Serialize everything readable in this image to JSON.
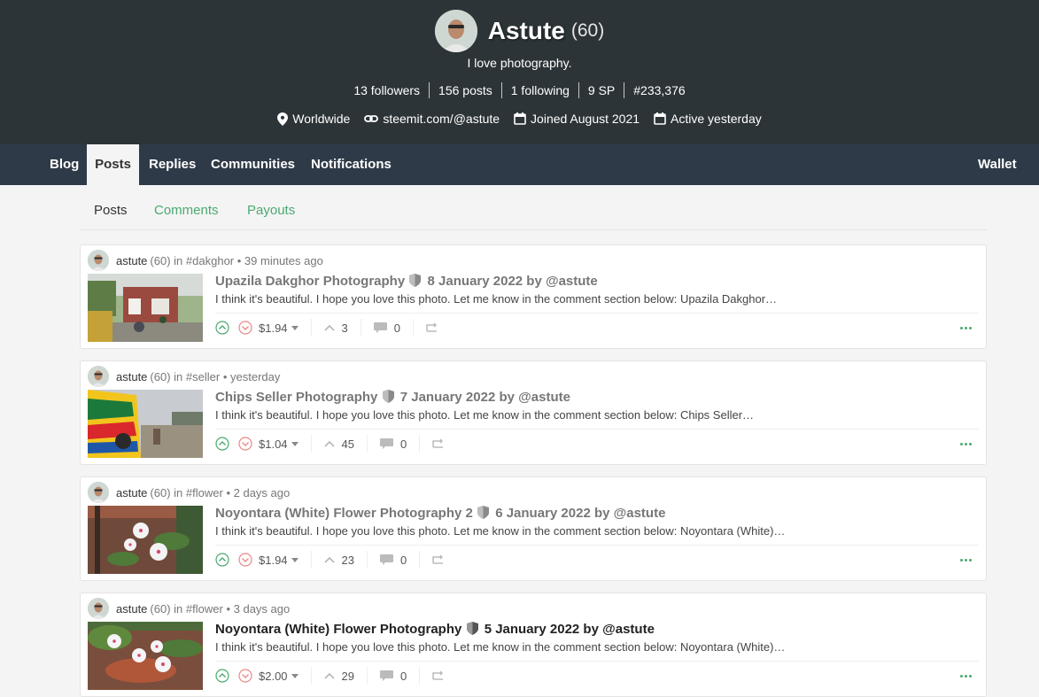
{
  "profile": {
    "name": "Astute",
    "reputation": "(60)",
    "about": "I love photography.",
    "stats": [
      "13 followers",
      "156 posts",
      "1 following",
      "9 SP",
      "#233,376"
    ],
    "location": "Worldwide",
    "website": "steemit.com/@astute",
    "joined": "Joined August 2021",
    "active": "Active yesterday"
  },
  "nav": {
    "blog": "Blog",
    "posts": "Posts",
    "replies": "Replies",
    "communities": "Communities",
    "notifications": "Notifications",
    "wallet": "Wallet"
  },
  "subnav": {
    "posts": "Posts",
    "comments": "Comments",
    "payouts": "Payouts"
  },
  "posts": [
    {
      "author": "astute",
      "rep": "(60)",
      "in_label": "in",
      "community": "#dakghor",
      "time": "39 minutes ago",
      "title_a": "Upazila Dakghor Photography",
      "title_b": "8 January 2022 by @astute",
      "excerpt": "I think it's beautiful. I hope you love this photo. Let me know in the comment section below: Upazila Dakghor…",
      "payout": "$1.94",
      "votes": "3",
      "comments": "0"
    },
    {
      "author": "astute",
      "rep": "(60)",
      "in_label": "in",
      "community": "#seller",
      "time": "yesterday",
      "title_a": "Chips Seller Photography",
      "title_b": "7 January 2022 by @astute",
      "excerpt": "I think it's beautiful. I hope you love this photo. Let me know in the comment section below: Chips Seller…",
      "payout": "$1.04",
      "votes": "45",
      "comments": "0"
    },
    {
      "author": "astute",
      "rep": "(60)",
      "in_label": "in",
      "community": "#flower",
      "time": "2 days ago",
      "title_a": "Noyontara (White) Flower Photography 2",
      "title_b": "6 January 2022 by @astute",
      "excerpt": "I think it's beautiful. I hope you love this photo. Let me know in the comment section below: Noyontara (White)…",
      "payout": "$1.94",
      "votes": "23",
      "comments": "0"
    },
    {
      "author": "astute",
      "rep": "(60)",
      "in_label": "in",
      "community": "#flower",
      "time": "3 days ago",
      "title_a": "Noyontara (White) Flower Photography",
      "title_b": "5 January 2022 by @astute",
      "excerpt": "I think it's beautiful. I hope you love this photo. Let me know in the comment section below: Noyontara (White)…",
      "payout": "$2.00",
      "votes": "29",
      "comments": "0"
    }
  ],
  "colors": {
    "header_bg": "#2c3437",
    "nav_bg": "#2e3a47",
    "accent_green": "#4ba971",
    "downvote_red": "#e88"
  },
  "icons": [
    "location-icon",
    "link-icon",
    "calendar-icon",
    "upvote-icon",
    "downvote-icon",
    "chevron-up-icon",
    "comment-icon",
    "reblog-icon",
    "more-icon",
    "shield-icon"
  ]
}
